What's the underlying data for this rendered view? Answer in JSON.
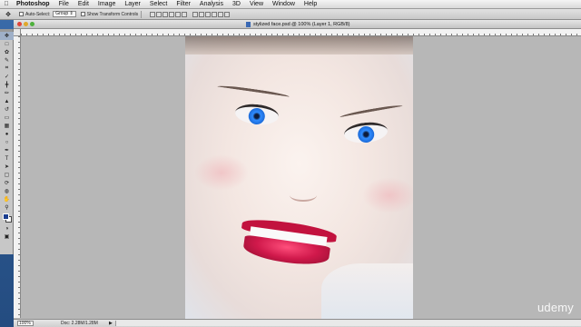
{
  "menubar": {
    "app_name": "Photoshop",
    "items": [
      "File",
      "Edit",
      "Image",
      "Layer",
      "Select",
      "Filter",
      "Analysis",
      "3D",
      "View",
      "Window",
      "Help"
    ]
  },
  "options_bar": {
    "auto_select_label": "Auto-Select:",
    "auto_select_value": "Group",
    "transform_label": "Show Transform Controls"
  },
  "document": {
    "title": "stylized face.psd @ 100% (Layer 1, RGB/8)"
  },
  "status_bar": {
    "zoom": "100%",
    "doc_info": "Doc: 2.28M/1.28M"
  },
  "watermark": "udemy",
  "colors": {
    "foreground": "#1b3e8f",
    "background": "#ffffff"
  },
  "toolbar": {
    "tools": [
      "move-icon",
      "marquee-icon",
      "lasso-icon",
      "quick-select-icon",
      "crop-icon",
      "eyedropper-icon",
      "healing-icon",
      "brush-icon",
      "clone-stamp-icon",
      "history-brush-icon",
      "eraser-icon",
      "gradient-icon",
      "blur-icon",
      "dodge-icon",
      "pen-icon",
      "type-icon",
      "path-select-icon",
      "shape-icon",
      "3d-rotate-icon",
      "3d-orbit-icon",
      "hand-icon",
      "zoom-icon"
    ]
  }
}
